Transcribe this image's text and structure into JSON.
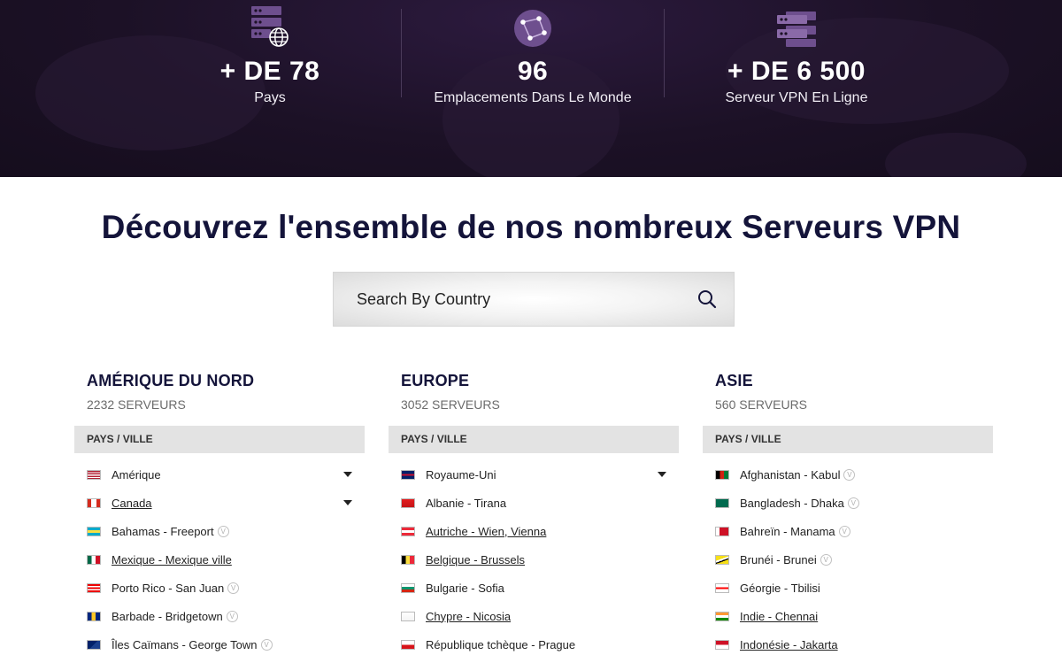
{
  "colors": {
    "hero_bg": "#1c1126",
    "title": "#14143a",
    "accent": "#6b4a8a"
  },
  "stats": [
    {
      "icon": "server-globe-icon",
      "value": "+ DE 78",
      "label": "Pays"
    },
    {
      "icon": "network-globe-icon",
      "value": "96",
      "label": "Emplacements Dans Le Monde"
    },
    {
      "icon": "server-rack-icon",
      "value": "+ DE 6 500",
      "label": "Serveur VPN En Ligne"
    }
  ],
  "heading": "Découvrez l'ensemble de nos nombreux Serveurs VPN",
  "search": {
    "placeholder": "Search By Country",
    "icon": "search-icon"
  },
  "regions": [
    {
      "title": "AMÉRIQUE DU NORD",
      "count": "2232 SERVEURS",
      "header": "PAYS / VILLE",
      "items": [
        {
          "flag": "us",
          "text": "Amérique",
          "link": false,
          "expandable": true,
          "v": false
        },
        {
          "flag": "ca",
          "text": "Canada",
          "link": true,
          "expandable": true,
          "v": false
        },
        {
          "flag": "bs",
          "text": "Bahamas - Freeport",
          "link": false,
          "expandable": false,
          "v": true
        },
        {
          "flag": "mx",
          "text": "Mexique - Mexique ville",
          "link": true,
          "expandable": false,
          "v": false
        },
        {
          "flag": "pr",
          "text": "Porto Rico - San Juan",
          "link": false,
          "expandable": false,
          "v": true
        },
        {
          "flag": "bb",
          "text": "Barbade - Bridgetown",
          "link": false,
          "expandable": false,
          "v": true
        },
        {
          "flag": "ky",
          "text": "Îles Caïmans - George Town",
          "link": false,
          "expandable": false,
          "v": true
        }
      ]
    },
    {
      "title": "EUROPE",
      "count": "3052 SERVEURS",
      "header": "PAYS / VILLE",
      "items": [
        {
          "flag": "gb",
          "text": "Royaume-Uni",
          "link": false,
          "expandable": true,
          "v": false
        },
        {
          "flag": "al",
          "text": "Albanie - Tirana",
          "link": false,
          "expandable": false,
          "v": false
        },
        {
          "flag": "at",
          "text": "Autriche - Wien, Vienna",
          "link": true,
          "expandable": false,
          "v": false
        },
        {
          "flag": "be",
          "text": "Belgique - Brussels",
          "link": true,
          "expandable": false,
          "v": false
        },
        {
          "flag": "bg",
          "text": "Bulgarie - Sofia",
          "link": false,
          "expandable": false,
          "v": false
        },
        {
          "flag": "cy",
          "text": "Chypre - Nicosia",
          "link": true,
          "expandable": false,
          "v": false
        },
        {
          "flag": "cz",
          "text": "République tchèque - Prague",
          "link": false,
          "expandable": false,
          "v": false
        }
      ]
    },
    {
      "title": "ASIE",
      "count": "560 SERVEURS",
      "header": "PAYS / VILLE",
      "items": [
        {
          "flag": "af",
          "text": "Afghanistan - Kabul",
          "link": false,
          "expandable": false,
          "v": true
        },
        {
          "flag": "bd",
          "text": "Bangladesh - Dhaka",
          "link": false,
          "expandable": false,
          "v": true
        },
        {
          "flag": "bh",
          "text": "Bahreïn - Manama",
          "link": false,
          "expandable": false,
          "v": true
        },
        {
          "flag": "bn",
          "text": "Brunéi - Brunei",
          "link": false,
          "expandable": false,
          "v": true
        },
        {
          "flag": "ge",
          "text": "Géorgie - Tbilisi",
          "link": false,
          "expandable": false,
          "v": false
        },
        {
          "flag": "in",
          "text": "Indie - Chennai",
          "link": true,
          "expandable": false,
          "v": false
        },
        {
          "flag": "id",
          "text": "Indonésie - Jakarta",
          "link": true,
          "expandable": false,
          "v": false
        }
      ]
    }
  ]
}
